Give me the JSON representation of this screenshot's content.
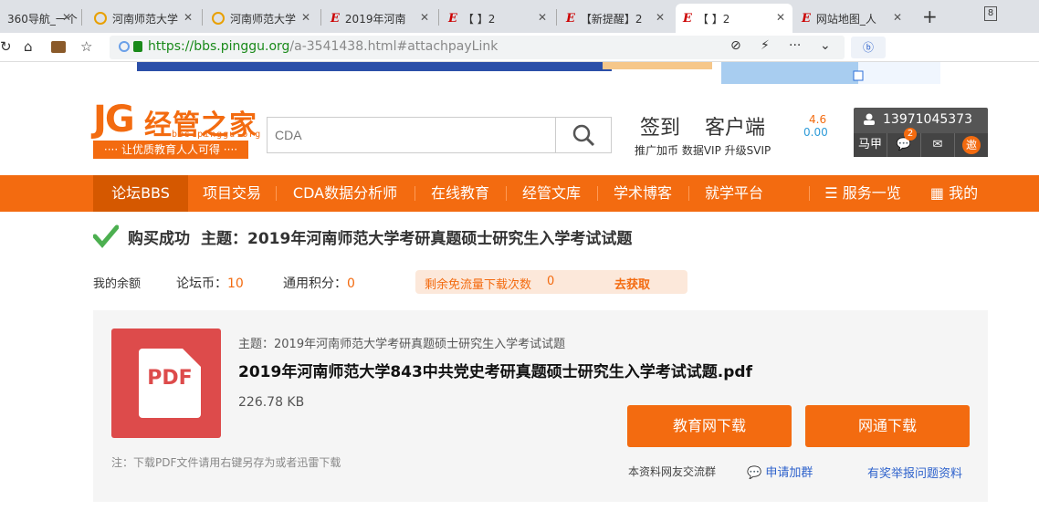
{
  "browser": {
    "tabs": [
      {
        "title": "360导航_一个",
        "icon": "none"
      },
      {
        "title": "河南师范大学",
        "icon": "search-q"
      },
      {
        "title": "河南师范大学",
        "icon": "search-q"
      },
      {
        "title": "2019年河南",
        "icon": "e"
      },
      {
        "title": "【         】2",
        "icon": "e"
      },
      {
        "title": "【新提醒】2",
        "icon": "e"
      },
      {
        "title": "【         】2",
        "icon": "e",
        "active": true
      },
      {
        "title": "网站地图_人",
        "icon": "e"
      }
    ],
    "new_tab": "+",
    "tab_count": "8",
    "url": {
      "protocol": "https://",
      "host": "bbs.pinggu.org",
      "path": "/a-3541438.html#attachpayLink"
    },
    "search_engine": "ⓑ"
  },
  "site": {
    "logo": {
      "jg": "JG",
      "name": "经管之家",
      "url": "bbs.pinggu.org",
      "slogan": "···· 让优质教育人人可得 ····"
    },
    "search": {
      "placeholder": "CDA"
    },
    "signin": "签到",
    "client": "客户端",
    "promo": "推广加币  数据VIP  升级SVIP",
    "stat1": "4.6",
    "stat2": "0.00",
    "user": {
      "phone": "13971045373",
      "name": "马甲",
      "badge": "2",
      "invite": "邀"
    }
  },
  "nav": {
    "items": [
      "论坛BBS",
      "项目交易",
      "CDA数据分析师",
      "在线教育",
      "经管文库",
      "学术博客",
      "就学平台"
    ],
    "service": "服务一览",
    "mine": "我的"
  },
  "purchase": {
    "status": "购买成功",
    "topic_label": "主题：2019年河南师范大学考研真题硕士研究生入学考试试题",
    "balance_label": "我的余额",
    "coin_label": "论坛币：",
    "coin_value": "10",
    "points_label": "通用积分：",
    "points_value": "0",
    "free_label": "剩余免流量下载次数",
    "free_value": "0",
    "free_get": "去获取"
  },
  "file": {
    "icon_text": "PDF",
    "topic": "主题：2019年河南师范大学考研真题硕士研究生入学考试试题",
    "name": "2019年河南师范大学843中共党史考研真题硕士研究生入学考试试题.pdf",
    "size": "226.78 KB",
    "note": "注：下载PDF文件请用右键另存为或者迅雷下载",
    "btn_edu": "教育网下载",
    "btn_net": "网通下载",
    "group_label": "本资料网友交流群",
    "group_action": "申请加群",
    "report": "有奖举报问题资料"
  },
  "colors": {
    "accent": "#f36b10",
    "link": "#2e62cc",
    "pdf": "#dd4b4b"
  }
}
